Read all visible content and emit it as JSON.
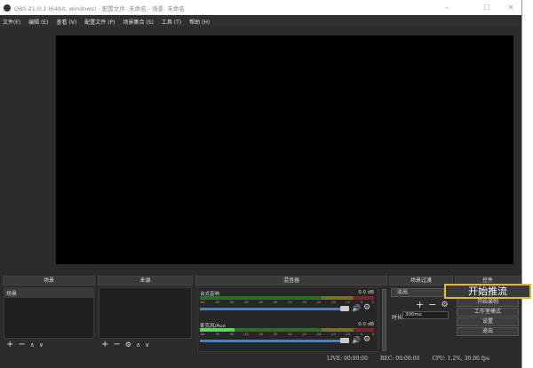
{
  "window": {
    "title": "OBS 21.0.1 (64bit, windows) - 配置文件: 未命名 - 场景: 未命名",
    "minimize": "–",
    "maximize": "☐",
    "close": "✕"
  },
  "menu": [
    "文件(F)",
    "编辑 (E)",
    "查看 (V)",
    "配置文件 (P)",
    "场景集合 (S)",
    "工具 (T)",
    "帮助 (H)"
  ],
  "scenes": {
    "header": "场景",
    "items": [
      "场景"
    ]
  },
  "sources": {
    "header": "来源"
  },
  "mixer": {
    "header": "混音器",
    "channels": [
      {
        "name": "台式音响",
        "db": "0.0 dB",
        "level": 0
      },
      {
        "name": "麦克风/Aux",
        "db": "0.0 dB",
        "level": 0.2
      }
    ],
    "ticks": [
      "-60",
      "-55",
      "-50",
      "-45",
      "-40",
      "-35",
      "-30",
      "-25",
      "-20",
      "-15",
      "-10",
      "-5",
      "0"
    ]
  },
  "transitions": {
    "header": "场景过渡",
    "selected": "淡出",
    "duration_label": "时长",
    "duration": "300ms"
  },
  "controls": {
    "header": "控件",
    "start_stream": "开始推流",
    "start_record": "开始录制",
    "studio_mode": "工作室模式",
    "settings": "设置",
    "exit": "退出"
  },
  "status": {
    "live": "LIVE: 00:00:00",
    "rec": "REC: 00:00:00",
    "cpu": "CPU: 1.2%, 30.00 fps"
  },
  "glyphs": {
    "plus": "+",
    "minus": "−",
    "up": "∧",
    "down": "∨",
    "gear": "⚙",
    "speaker": "🔊"
  }
}
